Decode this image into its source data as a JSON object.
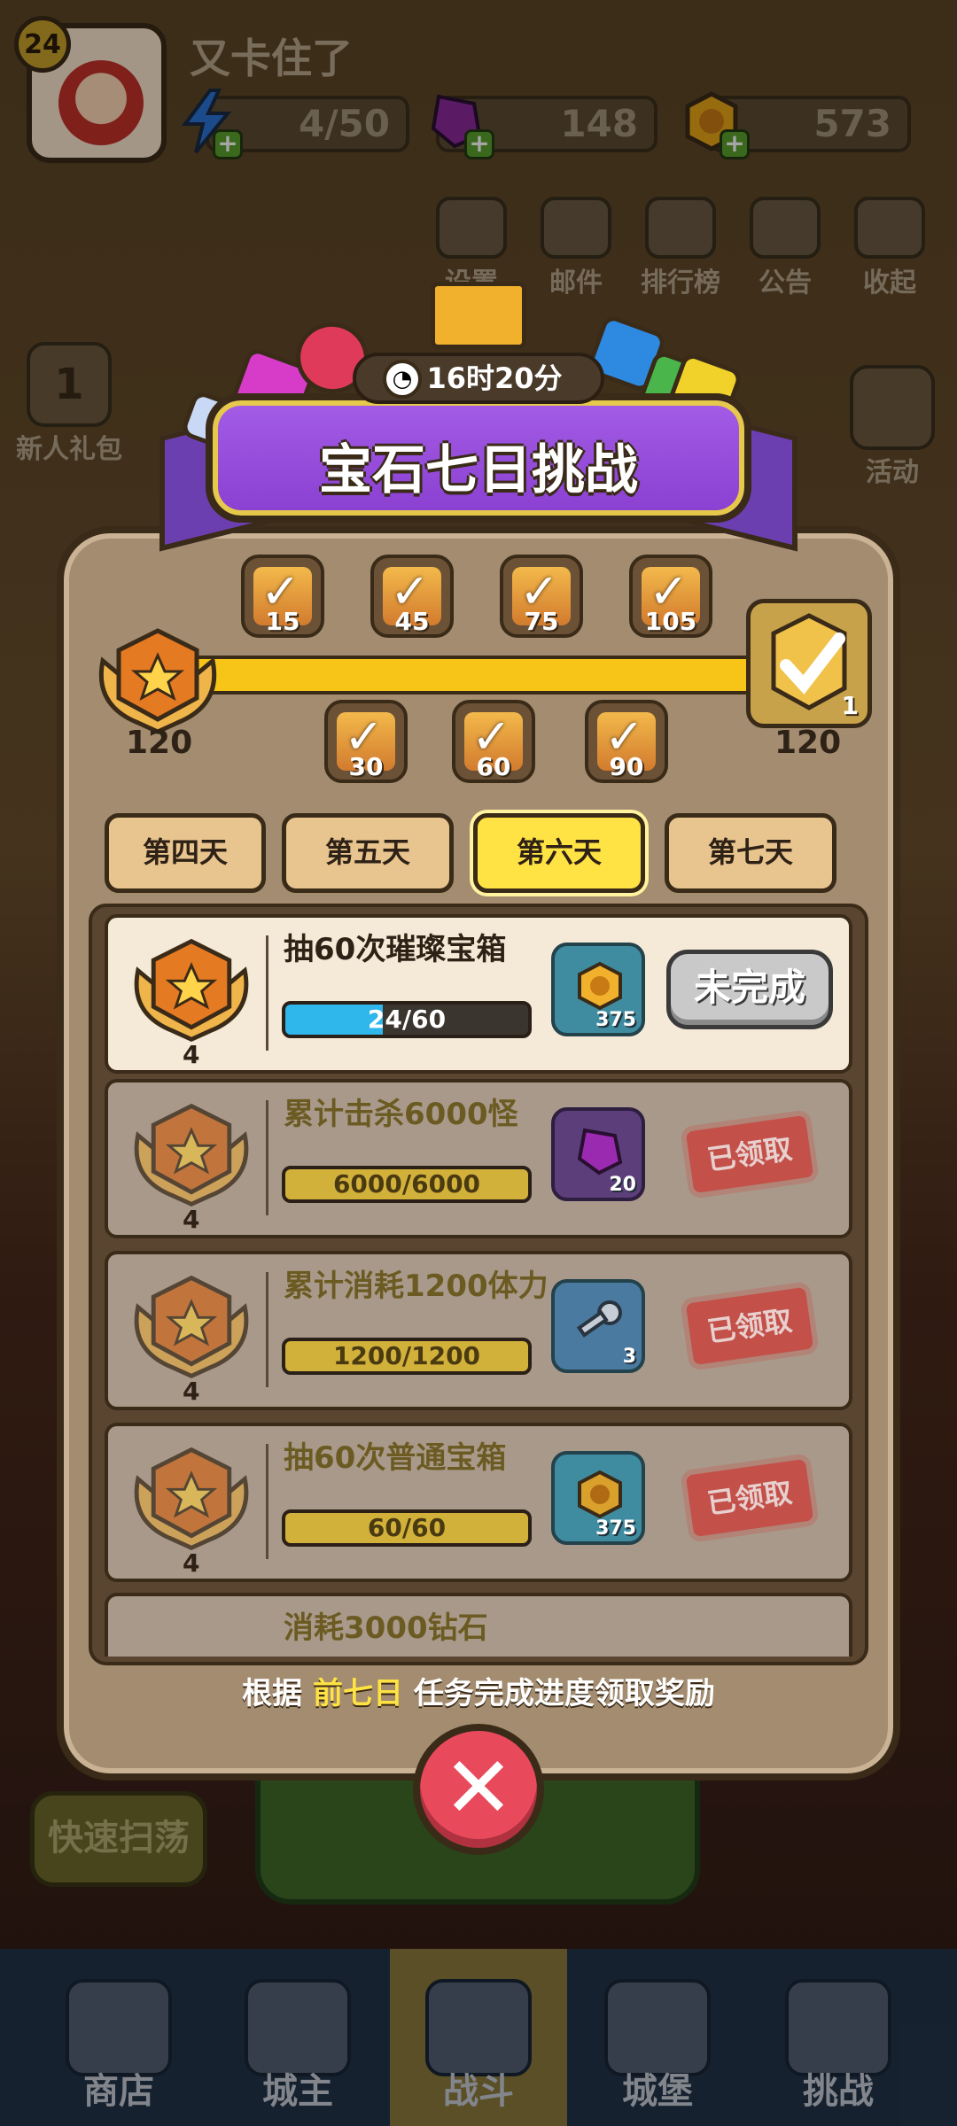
{
  "player": {
    "level": "24",
    "name": "又卡住了"
  },
  "resources": {
    "energy": "4/50",
    "gems": "148",
    "coins": "573"
  },
  "top_buttons": [
    "设置",
    "邮件",
    "排行榜",
    "公告",
    "收起"
  ],
  "side_left": [
    "1",
    "新人礼包"
  ],
  "side_right": [
    "活动"
  ],
  "modal": {
    "title": "宝石七日挑战",
    "timer": "16时20分",
    "start_value": "120",
    "end_value": "120",
    "final_chest_count": "1",
    "milestones_top": [
      "15",
      "45",
      "75",
      "105"
    ],
    "milestones_bottom": [
      "30",
      "60",
      "90"
    ],
    "tabs": [
      "第四天",
      "第五天",
      "第六天",
      "第七天"
    ],
    "active_tab": "第六天",
    "tasks": [
      {
        "title": "抽60次璀璨宝箱",
        "medal": "4",
        "progress": "24/60",
        "fill": 0.4,
        "reward_count": "375",
        "reward": "coin-icon",
        "status": "未完成"
      },
      {
        "title": "累计击杀6000怪",
        "medal": "4",
        "progress": "6000/6000",
        "fill": 1.0,
        "reward_count": "20",
        "reward": "gem-icon",
        "status": "已领取"
      },
      {
        "title": "累计消耗1200体力",
        "medal": "4",
        "progress": "1200/1200",
        "fill": 1.0,
        "reward_count": "3",
        "reward": "key-icon",
        "status": "已领取"
      },
      {
        "title": "抽60次普通宝箱",
        "medal": "4",
        "progress": "60/60",
        "fill": 1.0,
        "reward_count": "375",
        "reward": "coin-icon",
        "status": "已领取"
      },
      {
        "title": "消耗3000钻石"
      }
    ],
    "hint_prefix": "根据 ",
    "hint_highlight": "前七日",
    "hint_suffix": " 任务完成进度领取奖励"
  },
  "quick_sweep": "快速扫荡",
  "bottom_nav": [
    "商店",
    "城主",
    "战斗",
    "城堡",
    "挑战"
  ],
  "colors": {
    "accent_yellow": "#ffe243",
    "progress_blue": "#2fb6ea",
    "stamp_red": "#c8443e",
    "close_red": "#e84a5c"
  }
}
